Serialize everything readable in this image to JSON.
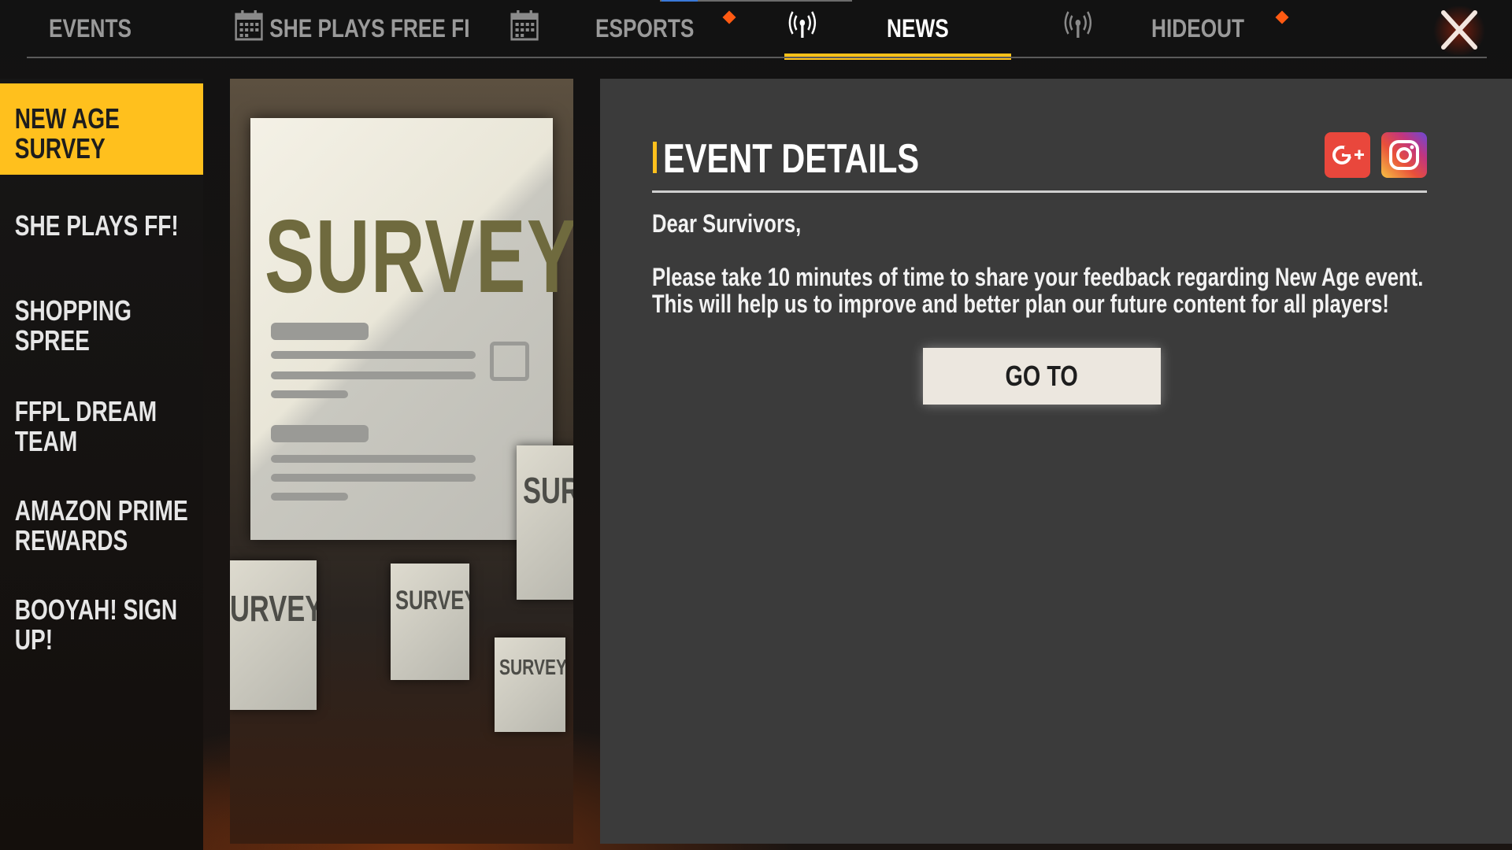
{
  "tabs": [
    {
      "label": "EVENTS",
      "icon": "none",
      "active": false
    },
    {
      "label": "SHE PLAYS FREE FI",
      "icon": "calendar-icon",
      "active": false
    },
    {
      "label": "ESPORTS",
      "icon": "calendar-icon",
      "active": false,
      "alert": true
    },
    {
      "label": "NEWS",
      "icon": "broadcast-icon",
      "active": true
    },
    {
      "label": "HIDEOUT",
      "icon": "broadcast-icon",
      "active": false,
      "alert": true
    }
  ],
  "sidebar": {
    "items": [
      {
        "label": "NEW AGE SURVEY",
        "active": true
      },
      {
        "label": "SHE PLAYS FF!",
        "active": false
      },
      {
        "label": "SHOPPING SPREE",
        "active": false
      },
      {
        "label": "FFPL DREAM TEAM",
        "active": false
      },
      {
        "label": "AMAZON PRIME REWARDS",
        "active": false
      },
      {
        "label": "BOOYAH! SIGN UP!",
        "active": false
      }
    ]
  },
  "banner": {
    "main_text": "SURVEY",
    "mini_1": "SUR",
    "mini_2": "URVEY",
    "mini_3": "SURVEY",
    "mini_4": "SURVEY"
  },
  "details": {
    "title": "EVENT DETAILS",
    "greeting": "Dear Survivors,",
    "body_line_1": "Please take 10 minutes of time to share your feedback regarding New Age event.",
    "body_line_2": "This will help us to improve and better plan our future content for all players!",
    "button_label": "GO TO",
    "social": [
      "google-plus-icon",
      "instagram-icon"
    ]
  },
  "colors": {
    "accent": "#ffc01d",
    "alert": "#ff5a12",
    "panel": "#3b3b3b"
  }
}
